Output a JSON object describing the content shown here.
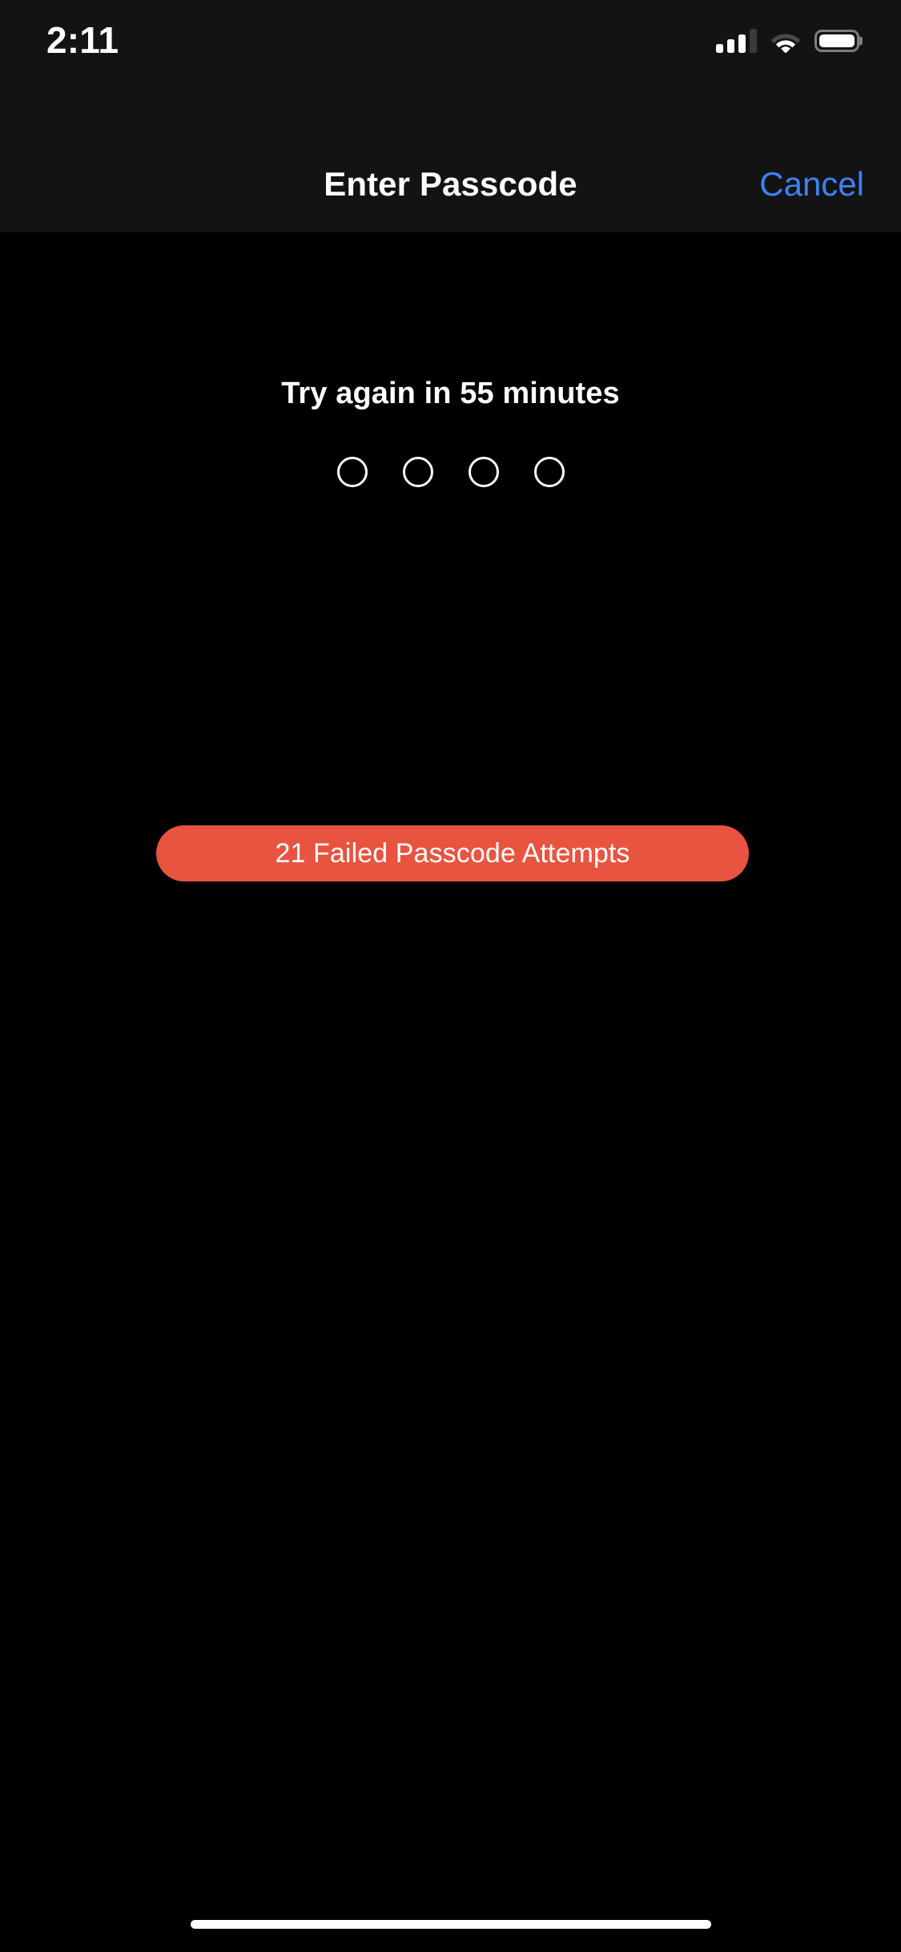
{
  "status_bar": {
    "time": "2:11",
    "cellular_icon": "cellular-signal-icon",
    "cellular_bars_active": 3,
    "cellular_bars_total": 4,
    "wifi_icon": "wifi-icon",
    "battery_icon": "battery-icon",
    "battery_level_percent": 100,
    "background_color": "#131313"
  },
  "nav_bar": {
    "title": "Enter Passcode",
    "cancel_label": "Cancel",
    "cancel_color": "#3c82f6",
    "background_color": "#131313"
  },
  "main": {
    "retry_message": "Try again in 55 minutes",
    "passcode": {
      "length": 4,
      "entered": 0,
      "dots": [
        {
          "filled": false
        },
        {
          "filled": false
        },
        {
          "filled": false
        },
        {
          "filled": false
        }
      ]
    },
    "failed_attempts_badge": {
      "label": "21 Failed Passcode Attempts",
      "count": 21,
      "background_color": "#e8543f",
      "text_color": "#ffffff"
    },
    "background_color": "#000000"
  },
  "home_indicator": {
    "name": "home-indicator",
    "color": "#ffffff"
  }
}
